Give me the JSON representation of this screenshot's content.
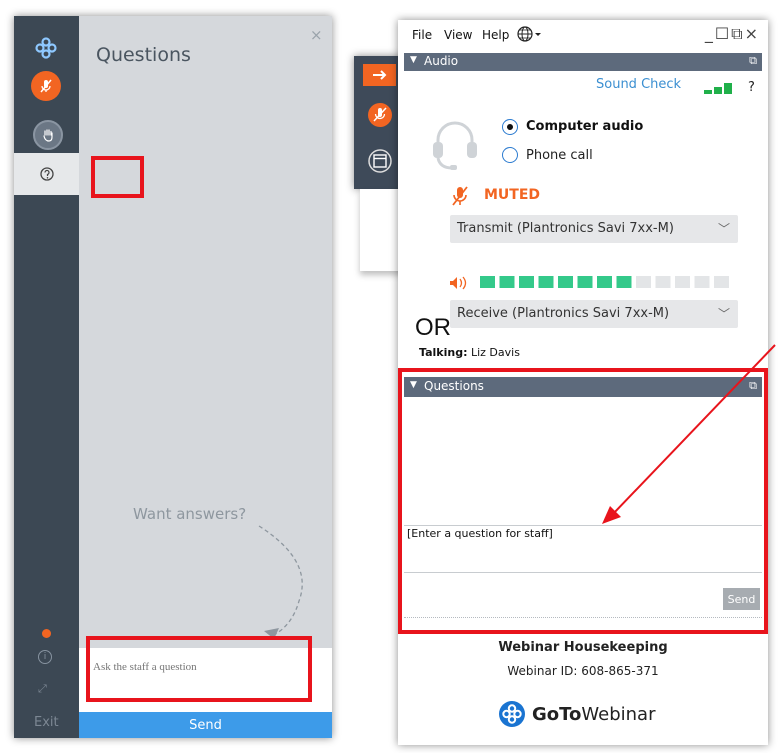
{
  "left_panel": {
    "title": "Questions",
    "close_glyph": "×",
    "want_answers": "Want answers?",
    "input_placeholder": "Ask the staff a question",
    "send_label": "Send",
    "exit_label": "Exit",
    "accent_orange": "#f26522",
    "send_blue": "#3d9be9"
  },
  "window": {
    "menu": [
      "File",
      "View",
      "Help"
    ],
    "window_controls": "_☐⧉×",
    "audio_section": {
      "header": "Audio",
      "sound_check": "Sound Check",
      "help": "?",
      "options": [
        "Computer audio",
        "Phone call"
      ],
      "selected_option": "Computer audio",
      "muted_label": "MUTED",
      "transmit_device": "Transmit (Plantronics Savi 7xx-M)",
      "receive_device": "Receive (Plantronics Savi 7xx-M)",
      "speaker_level_active": 8,
      "speaker_level_total": 13
    },
    "or_label": "OR",
    "talking_label": "Talking:",
    "talking_name": "Liz Davis",
    "questions_section": {
      "header": "Questions",
      "input_placeholder": "[Enter a question for staff]",
      "send_label": "Send"
    },
    "webinar_title": "Webinar Housekeeping",
    "webinar_id": "Webinar ID: 608-865-371",
    "brand_bold": "GoTo",
    "brand_regular": "Webinar"
  },
  "annotation_color": "#e8141c"
}
